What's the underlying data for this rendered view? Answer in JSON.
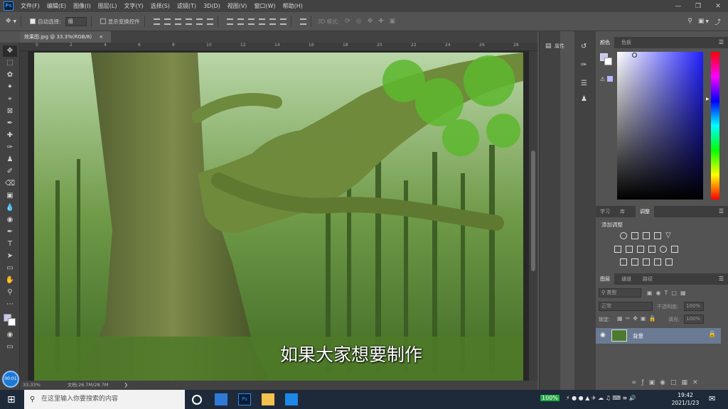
{
  "app": {
    "logo": "Ps"
  },
  "menu": [
    "文件(F)",
    "编辑(E)",
    "图像(I)",
    "图层(L)",
    "文字(Y)",
    "选择(S)",
    "滤镜(T)",
    "3D(D)",
    "视图(V)",
    "窗口(W)",
    "帮助(H)"
  ],
  "options": {
    "auto_select_label": "自动选择:",
    "auto_select_value": "组",
    "show_transform_label": "显示变换控件",
    "mode_3d_label": "3D 模式:"
  },
  "document": {
    "tab_title": "效果图.jpg @ 33.3%(RGB/8)",
    "close_glyph": "×"
  },
  "ruler": {
    "h_ticks": [
      "0",
      "2",
      "4",
      "6",
      "8",
      "10",
      "12",
      "14",
      "16",
      "18",
      "20",
      "22",
      "24",
      "26",
      "28"
    ]
  },
  "canvas": {
    "subtitle": "如果大家想要制作"
  },
  "status": {
    "zoom": "33.33%",
    "doc_info": "文档:26.7M/28.7M"
  },
  "panels": {
    "properties_label": "属性",
    "color_tabs": [
      "颜色",
      "色板"
    ],
    "adjust_tabs": [
      "学习",
      "库",
      "调整"
    ],
    "adjust_title": "添加调整",
    "layer_tabs": [
      "图层",
      "通道",
      "路径"
    ],
    "layer_search": "类型",
    "blend_mode": "正常",
    "opacity_label": "不透明度:",
    "opacity_value": "100%",
    "lock_label": "锁定:",
    "fill_label": "填充:",
    "fill_value": "100%",
    "layer_name": "背景"
  },
  "taskbar": {
    "search_placeholder": "在这里输入你要搜索的内容",
    "battery": "100%",
    "time": "19:42",
    "date": "2021/1/23",
    "badge": "00:01"
  }
}
